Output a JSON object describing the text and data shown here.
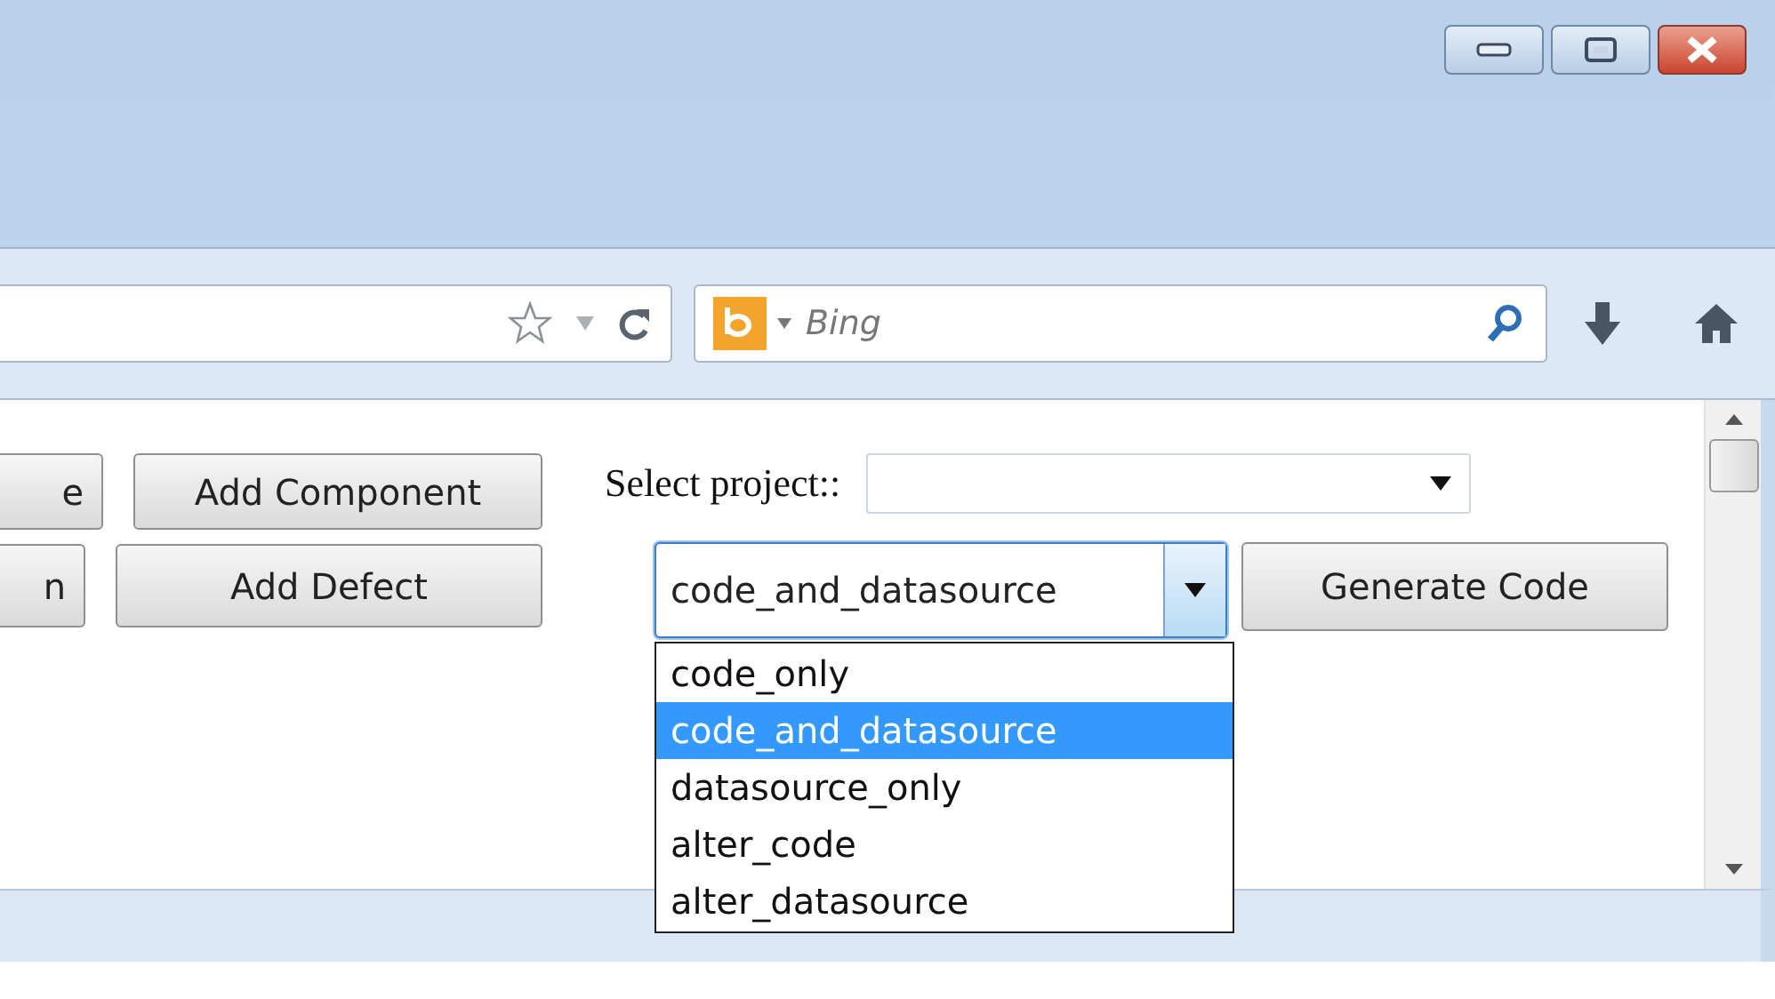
{
  "toolbar": {
    "search": {
      "placeholder": "Bing"
    }
  },
  "button_rows": [
    {
      "cut_button": "e",
      "button": "Add Component"
    },
    {
      "cut_button": "n",
      "button": "Add Defect"
    }
  ],
  "project_select": {
    "label": "Select project::"
  },
  "mode_select": {
    "value": "code_and_datasource",
    "expanded": true,
    "options": [
      {
        "label": "code_only",
        "selected": false
      },
      {
        "label": "code_and_datasource",
        "selected": true
      },
      {
        "label": "datasource_only",
        "selected": false
      },
      {
        "label": "alter_code",
        "selected": false
      },
      {
        "label": "alter_datasource",
        "selected": false
      }
    ]
  },
  "generate_button": "Generate Code"
}
